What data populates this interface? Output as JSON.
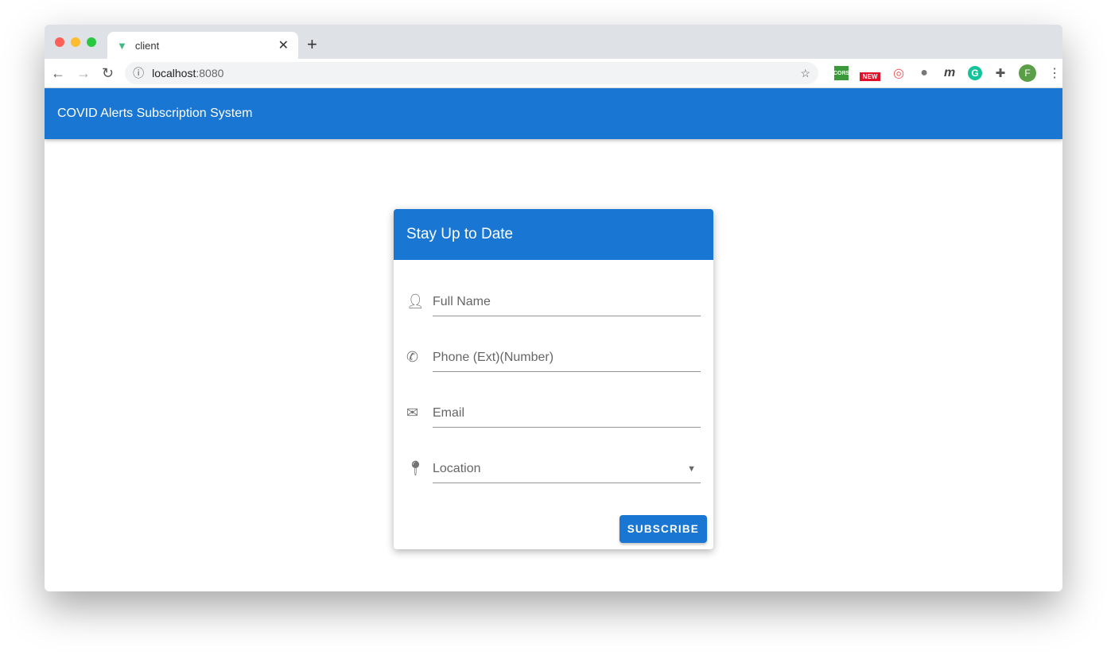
{
  "browser": {
    "tab_title": "client",
    "url_host": "localhost",
    "url_port": ":8080",
    "extensions": [
      "cors-icon",
      "new-badge-icon",
      "swirl-icon",
      "tomato-icon",
      "m-icon",
      "grammarly-icon",
      "puzzle-icon"
    ],
    "cors": "CORS",
    "new": "NEW",
    "m": "m",
    "profile": "F"
  },
  "app": {
    "title": "COVID Alerts Subscription System"
  },
  "card": {
    "title": "Stay Up to Date",
    "fields": [
      {
        "label": "Full Name",
        "icon": "person-icon"
      },
      {
        "label": "Phone (Ext)(Number)",
        "icon": "phone-icon"
      },
      {
        "label": "Email",
        "icon": "email-icon"
      },
      {
        "label": "Location",
        "icon": "location-icon"
      }
    ],
    "subscribe": "SUBSCRIBE"
  },
  "colors": {
    "primary": "#1976d2"
  }
}
